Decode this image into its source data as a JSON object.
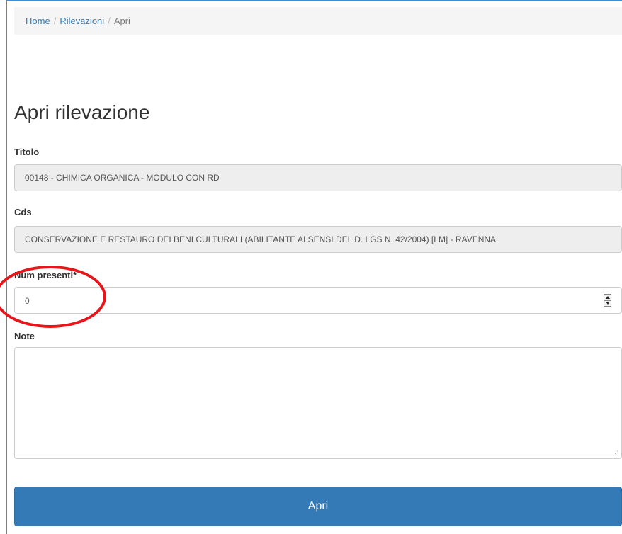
{
  "breadcrumb": {
    "home": "Home",
    "rilevazioni": "Rilevazioni",
    "current": "Apri",
    "separator": "/"
  },
  "page_title": "Apri rilevazione",
  "form": {
    "titolo_label": "Titolo",
    "titolo_value": "00148 - CHIMICA ORGANICA - MODULO  CON RD",
    "cds_label": "Cds",
    "cds_value": "CONSERVAZIONE E RESTAURO DEI BENI CULTURALI (ABILITANTE AI SENSI DEL D. LGS N. 42/2004) [LM] - RAVENNA",
    "num_presenti_label": "Num presenti*",
    "num_presenti_value": "0",
    "note_label": "Note",
    "note_value": "",
    "submit_label": "Apri"
  },
  "colors": {
    "primary": "#337ab7",
    "annotation": "#e8161b"
  }
}
